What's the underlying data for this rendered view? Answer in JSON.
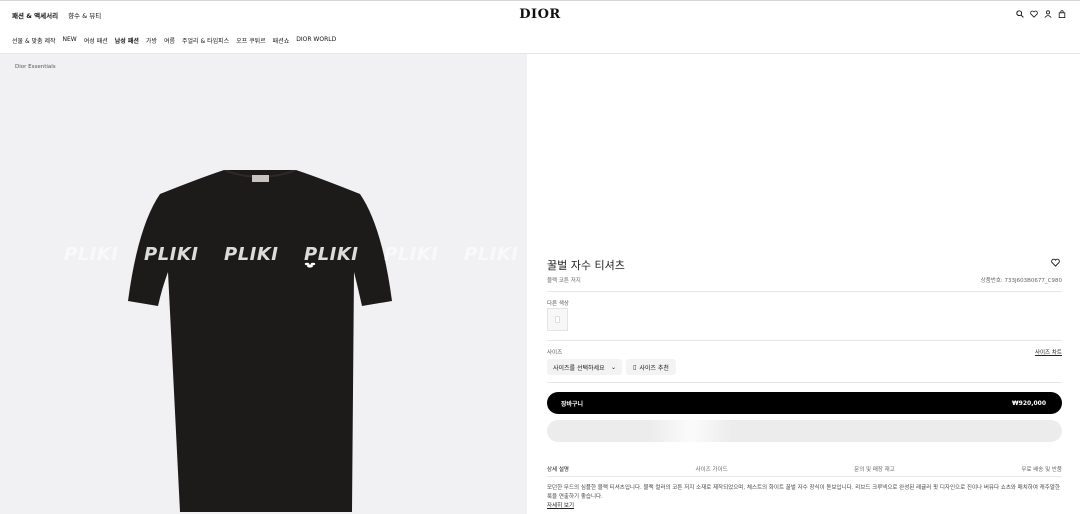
{
  "header": {
    "left_tabs": [
      "패션 & 액세서리",
      "향수 & 뷰티"
    ],
    "brand": "DIOR",
    "icons": [
      "search-icon",
      "heart-icon",
      "user-icon",
      "bag-icon"
    ]
  },
  "nav": {
    "items": [
      "선물 & 맞춤 제작",
      "NEW",
      "여성 패션",
      "남성 패션",
      "가방",
      "여름",
      "주얼리 & 타임피스",
      "오프 쿠튀르",
      "패션쇼",
      "DIOR WORLD"
    ]
  },
  "gallery": {
    "breadcrumb": "Dior Essentials",
    "watermark": "PLIKI"
  },
  "product": {
    "title": "꿀벌 자수 티셔츠",
    "subtitle": "블랙 코튼 저지",
    "reference": "상품번호: 733J603B0677_C980",
    "other_colors_label": "다른 색상",
    "size_label": "사이즈",
    "size_chart": "사이즈 차트",
    "size_select": "사이즈를 선택하세요",
    "size_recommend": "사이즈 추천",
    "cart_label": "장바구니",
    "price": "₩920,000"
  },
  "details": {
    "tabs": [
      "상세 설명",
      "사이즈 가이드",
      "문의 및 매장 재고",
      "무료 배송 및 반품"
    ],
    "description": "모던한 무드의 심플한 블랙 티셔츠입니다. 블랙 컬러의 코튼 저지 소재로 제작되었으며, 체스트의 화이트 꿀벌 자수 장식이 돋보입니다. 리브드 크루넥으로 완성된 레귤러 핏 디자인으로 진이나 버뮤다 쇼츠와 매치하여 캐주얼한 룩을 연출하기 좋습니다.",
    "more_link": "자세히 보기"
  },
  "colors": {
    "shirt": "#1d1a1a",
    "button": "#000000",
    "background_left": "#f1f1f3"
  }
}
